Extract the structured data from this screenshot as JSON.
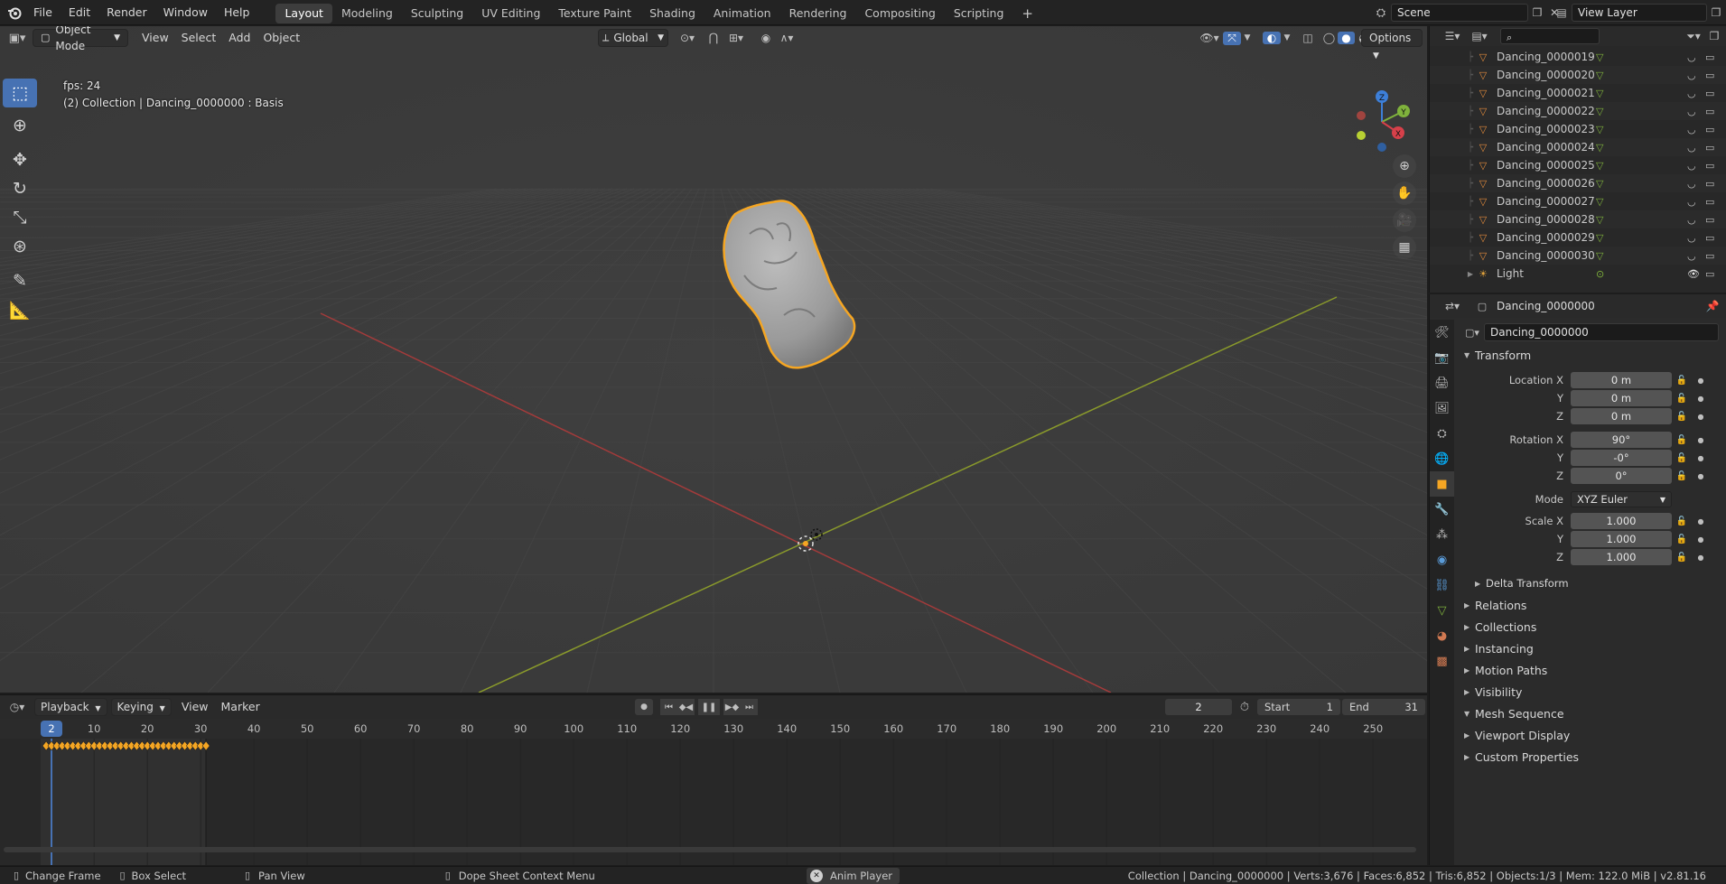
{
  "topbar": {
    "menu": [
      "File",
      "Edit",
      "Render",
      "Window",
      "Help"
    ],
    "workspaces": [
      "Layout",
      "Modeling",
      "Sculpting",
      "UV Editing",
      "Texture Paint",
      "Shading",
      "Animation",
      "Rendering",
      "Compositing",
      "Scripting"
    ],
    "active_workspace": "Layout",
    "add_tab": "+",
    "scene_name": "Scene",
    "view_layer": "View Layer"
  },
  "viewport": {
    "mode": "Object Mode",
    "menus": [
      "View",
      "Select",
      "Add",
      "Object"
    ],
    "orientation": "Global",
    "options_label": "Options",
    "fps_text": "fps: 24",
    "info_text": "(2) Collection | Dancing_0000000 : Basis",
    "gizmo_axes": {
      "z": "Z",
      "y": "Y",
      "x": "X"
    }
  },
  "timeline": {
    "menus": [
      "Playback",
      "Keying",
      "View",
      "Marker"
    ],
    "current_frame": "2",
    "start_label": "Start",
    "start_value": "1",
    "end_label": "End",
    "end_value": "31",
    "ruler_ticks": [
      "10",
      "20",
      "30",
      "40",
      "50",
      "60",
      "70",
      "80",
      "90",
      "100",
      "110",
      "120",
      "130",
      "140",
      "150",
      "160",
      "170",
      "180",
      "190",
      "200",
      "210",
      "220",
      "230",
      "240",
      "250"
    ],
    "playhead_label": "2"
  },
  "outliner": {
    "items": [
      "Dancing_0000019",
      "Dancing_0000020",
      "Dancing_0000021",
      "Dancing_0000022",
      "Dancing_0000023",
      "Dancing_0000024",
      "Dancing_0000025",
      "Dancing_0000026",
      "Dancing_0000027",
      "Dancing_0000028",
      "Dancing_0000029",
      "Dancing_0000030"
    ],
    "light_label": "Light"
  },
  "properties": {
    "header_object": "Dancing_0000000",
    "object_name": "Dancing_0000000",
    "transform_title": "Transform",
    "location": {
      "label_x": "Location X",
      "x": "0 m",
      "y": "0 m",
      "z": "0 m"
    },
    "rotation": {
      "label_x": "Rotation X",
      "x": "90°",
      "y": "-0°",
      "z": "0°"
    },
    "mode_label": "Mode",
    "mode_value": "XYZ Euler",
    "scale": {
      "label_x": "Scale X",
      "x": "1.000",
      "y": "1.000",
      "z": "1.000"
    },
    "axis_y": "Y",
    "axis_z": "Z",
    "delta_transform": "Delta Transform",
    "panels_collapsed": [
      "Relations",
      "Collections",
      "Instancing",
      "Motion Paths",
      "Visibility"
    ],
    "mesh_sequence": "Mesh Sequence",
    "panels_collapsed_2": [
      "Viewport Display",
      "Custom Properties"
    ]
  },
  "statusbar": {
    "change_frame": "Change Frame",
    "box_select": "Box Select",
    "pan_view": "Pan View",
    "context_menu": "Dope Sheet Context Menu",
    "anim_player": "Anim Player",
    "stats": "Collection | Dancing_0000000 | Verts:3,676 | Faces:6,852 | Tris:6,852 | Objects:1/3 | Mem: 122.0 MiB | v2.81.16"
  },
  "colors": {
    "accent": "#4772b3",
    "selection_outline": "#f5a623",
    "x_axis": "#a33b3b",
    "y_axis": "#8a9a2b",
    "viewport_bg": "#3c3c3c"
  }
}
